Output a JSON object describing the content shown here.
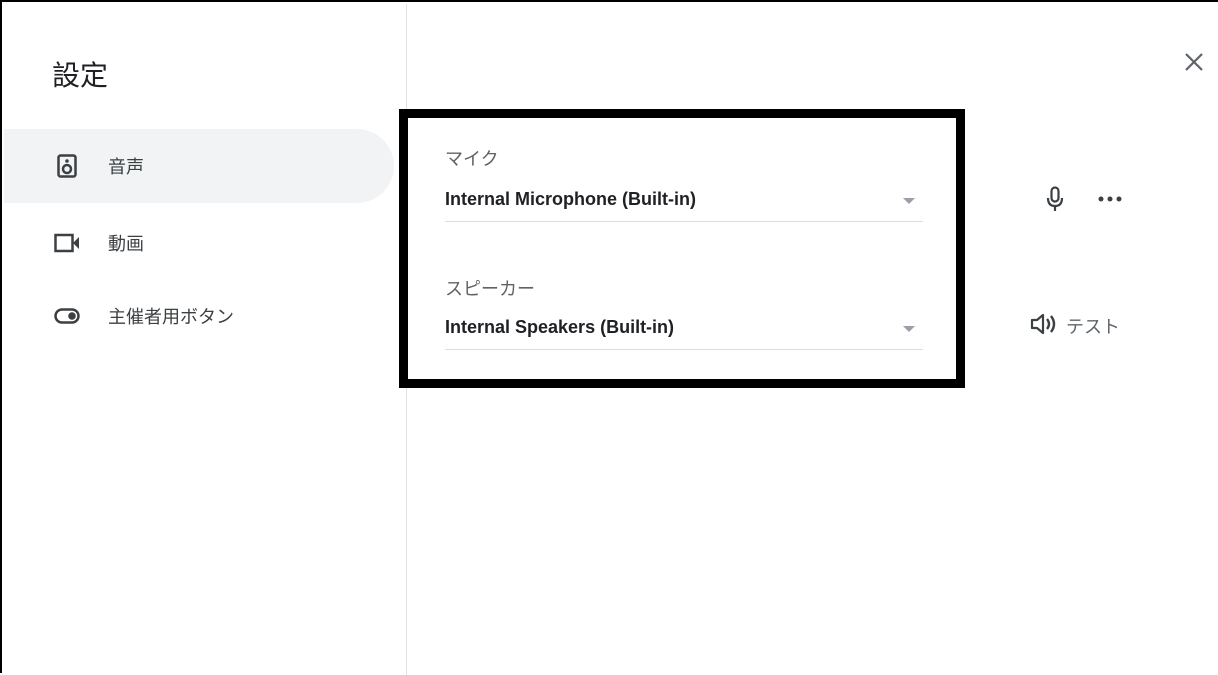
{
  "dialog": {
    "title": "設定"
  },
  "sidebar": {
    "items": [
      {
        "label": "音声",
        "icon": "speaker-icon",
        "active": true
      },
      {
        "label": "動画",
        "icon": "videocam-icon",
        "active": false
      },
      {
        "label": "主催者用ボタン",
        "icon": "toggle-icon",
        "active": false
      }
    ]
  },
  "audio": {
    "microphone": {
      "label": "マイク",
      "value": "Internal Microphone (Built-in)"
    },
    "speaker": {
      "label": "スピーカー",
      "value": "Internal Speakers (Built-in)"
    },
    "test_label": "テスト"
  },
  "icons": {
    "close": "close-icon",
    "mic": "microphone-icon",
    "more": "more-horiz-icon",
    "volume": "volume-icon"
  },
  "colors": {
    "active_bg": "#f1f3f4",
    "highlight_border": "#000000",
    "icon": "#5f6368"
  }
}
